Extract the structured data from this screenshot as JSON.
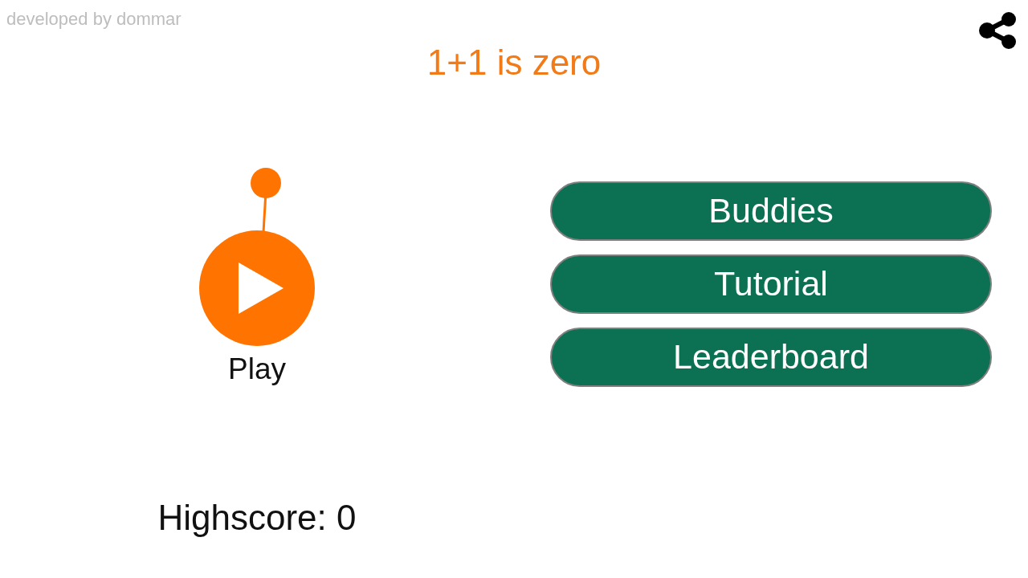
{
  "credit": "developed by dommar",
  "title": "1+1 is zero",
  "play": {
    "label": "Play"
  },
  "menu_buttons": [
    {
      "label": "Buddies"
    },
    {
      "label": "Tutorial"
    },
    {
      "label": "Leaderboard"
    }
  ],
  "highscore": "Highscore: 0"
}
